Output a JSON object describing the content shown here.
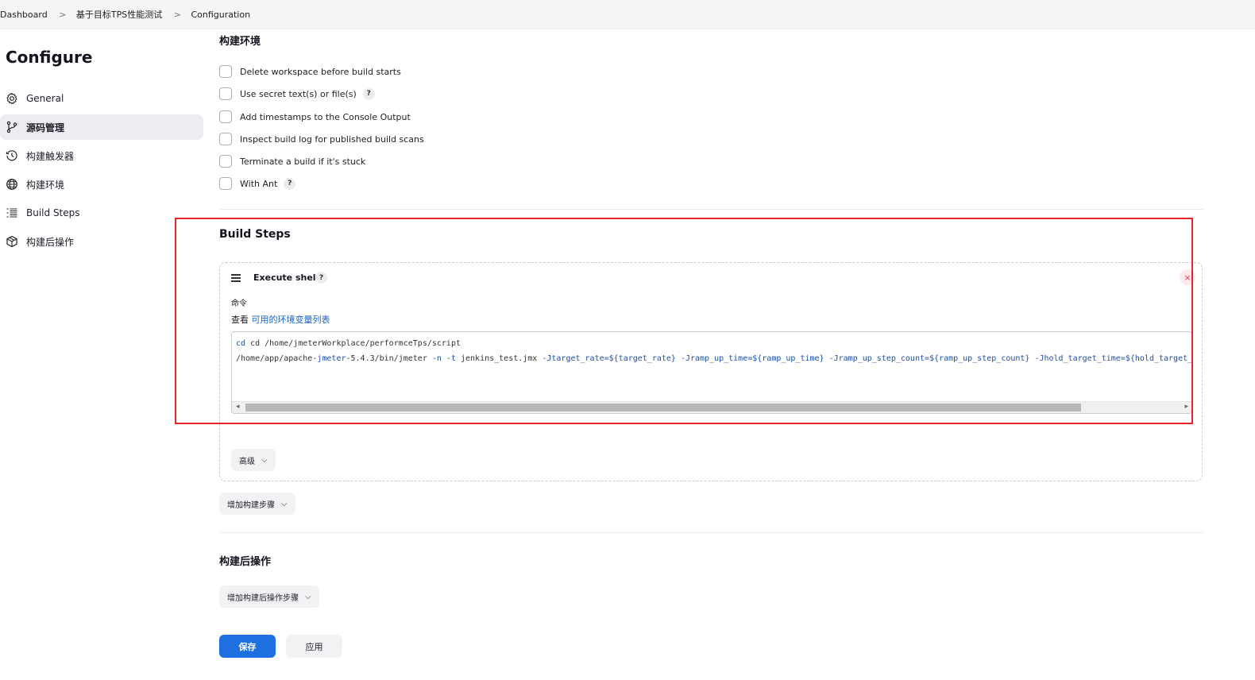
{
  "breadcrumb": {
    "items": [
      "Dashboard",
      "基于目标TPS性能测试",
      "Configuration"
    ],
    "separator": ">"
  },
  "page_title": "Configure",
  "sidebar": {
    "items": [
      {
        "label": "General",
        "icon": "gear-icon"
      },
      {
        "label": "源码管理",
        "icon": "branch-icon",
        "active": true
      },
      {
        "label": "构建触发器",
        "icon": "clock-icon"
      },
      {
        "label": "构建环境",
        "icon": "globe-icon"
      },
      {
        "label": "Build Steps",
        "icon": "list-icon"
      },
      {
        "label": "构建后操作",
        "icon": "package-icon"
      }
    ]
  },
  "build_env": {
    "heading": "构建环境",
    "options": [
      {
        "label": "Delete workspace before build starts",
        "checked": false,
        "help": false
      },
      {
        "label": "Use secret text(s) or file(s)",
        "checked": false,
        "help": true
      },
      {
        "label": "Add timestamps to the Console Output",
        "checked": false,
        "help": false
      },
      {
        "label": "Inspect build log for published build scans",
        "checked": false,
        "help": false
      },
      {
        "label": "Terminate a build if it's stuck",
        "checked": false,
        "help": false
      },
      {
        "label": "With Ant",
        "checked": false,
        "help": true
      }
    ],
    "help_glyph": "?"
  },
  "build_steps": {
    "heading": "Build Steps",
    "step": {
      "title": "Execute shell",
      "close_glyph": "×",
      "command_label": "命令",
      "env_prefix": "查看",
      "env_link": "可用的环境变量列表",
      "code_line1": "cd /home/jmeterWorkplace/performceTps/script",
      "code_line2_a": "/home/app/apache-",
      "code_line2_b": "jmeter",
      "code_line2_c": "-5.4.3/bin/jmeter ",
      "code_line2_d": "-n -t",
      "code_line2_e": " jenkins_test.jmx ",
      "code_line2_f": "-Jtarget_rate=${target_rate} -Jramp_up_time=${ramp_up_time} -Jramp_up_step_count=${ramp_up_step_count} -Jhold_target_time=${hold_target_time}",
      "advanced_label": "高级"
    },
    "add_step_label": "增加构建步骤"
  },
  "post_build": {
    "heading": "构建后操作",
    "add_label": "增加构建后操作步骤"
  },
  "actions": {
    "save": "保存",
    "apply": "应用"
  },
  "colors": {
    "primary": "#1e6fe0",
    "highlight_box": "#e8232a",
    "link": "#1963c8"
  }
}
